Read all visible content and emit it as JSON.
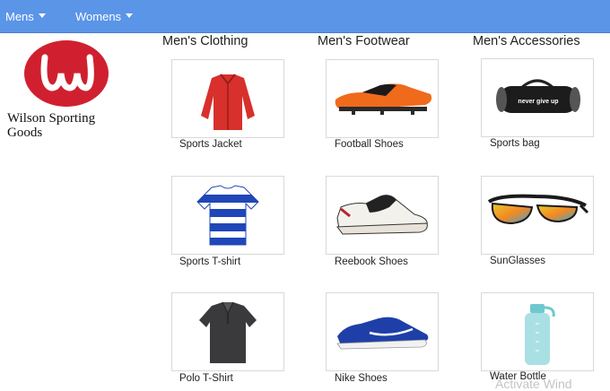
{
  "nav": {
    "items": [
      {
        "label": "Mens"
      },
      {
        "label": "Womens"
      }
    ]
  },
  "brand": {
    "name": "Wilson Sporting Goods",
    "logo_letter": "W",
    "logo_color": "#d0202f"
  },
  "columns": [
    {
      "title": "Men's Clothing",
      "products": [
        {
          "label": "Sports Jacket",
          "icon": "jacket-icon"
        },
        {
          "label": "Sports T-shirt",
          "icon": "striped-tshirt-icon"
        },
        {
          "label": "Polo T-Shirt",
          "icon": "polo-shirt-icon"
        }
      ]
    },
    {
      "title": "Men's Footwear",
      "products": [
        {
          "label": "Football Shoes",
          "icon": "football-shoe-icon"
        },
        {
          "label": "Reebook Shoes",
          "icon": "sneaker-icon"
        },
        {
          "label": "Nike Shoes",
          "icon": "running-shoe-icon"
        }
      ]
    },
    {
      "title": "Men's Accessories",
      "products": [
        {
          "label": "Sports bag",
          "icon": "duffel-bag-icon",
          "print": "never give up"
        },
        {
          "label": "SunGlasses",
          "icon": "sunglasses-icon"
        },
        {
          "label": "Water Bottle",
          "icon": "water-bottle-icon"
        }
      ]
    }
  ],
  "watermark": "Activate Wind",
  "colors": {
    "navbar": "#5b95e8",
    "card_border": "#d9d9d9"
  }
}
